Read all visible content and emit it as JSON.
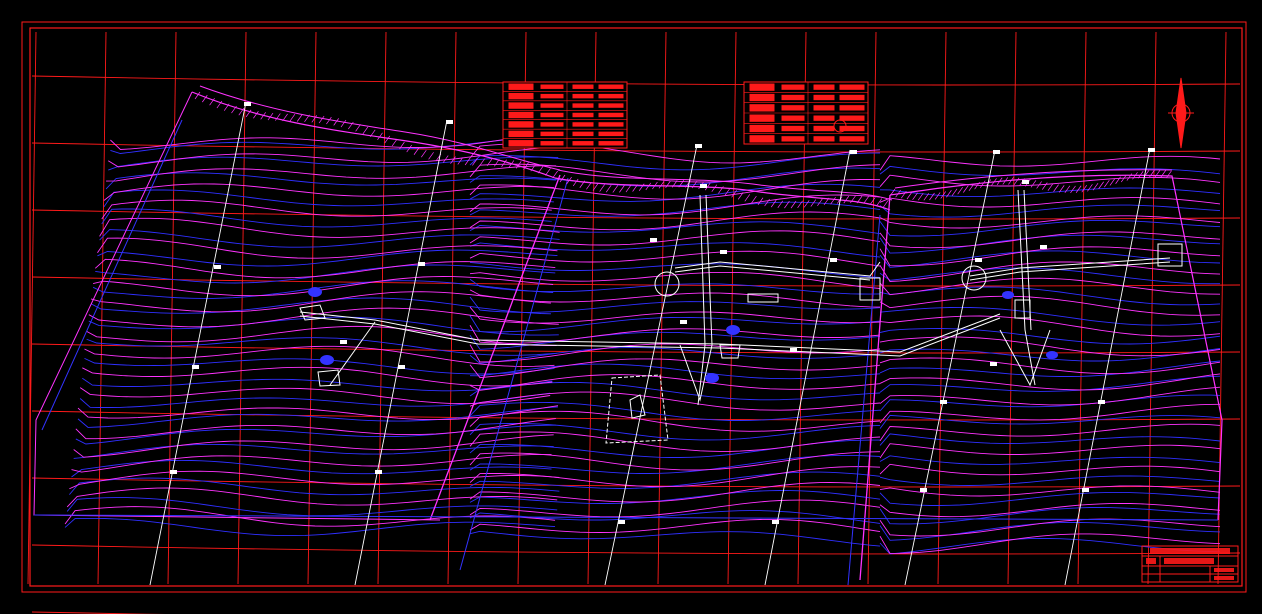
{
  "drawing": {
    "background": "#000000",
    "colors": {
      "frame": "#ff1a1a",
      "contour_primary": "#ff33ff",
      "contour_secondary": "#3333ff",
      "construction": "#ffffff"
    }
  },
  "legend_left": {
    "title": "",
    "rows": 7
  },
  "legend_right": {
    "title": "",
    "rows": 6
  },
  "title_block": {
    "org": "",
    "line2": "",
    "drawing_name": ""
  },
  "north_arrow": {
    "icon": "north-arrow-icon"
  },
  "marker": {
    "label": ""
  }
}
